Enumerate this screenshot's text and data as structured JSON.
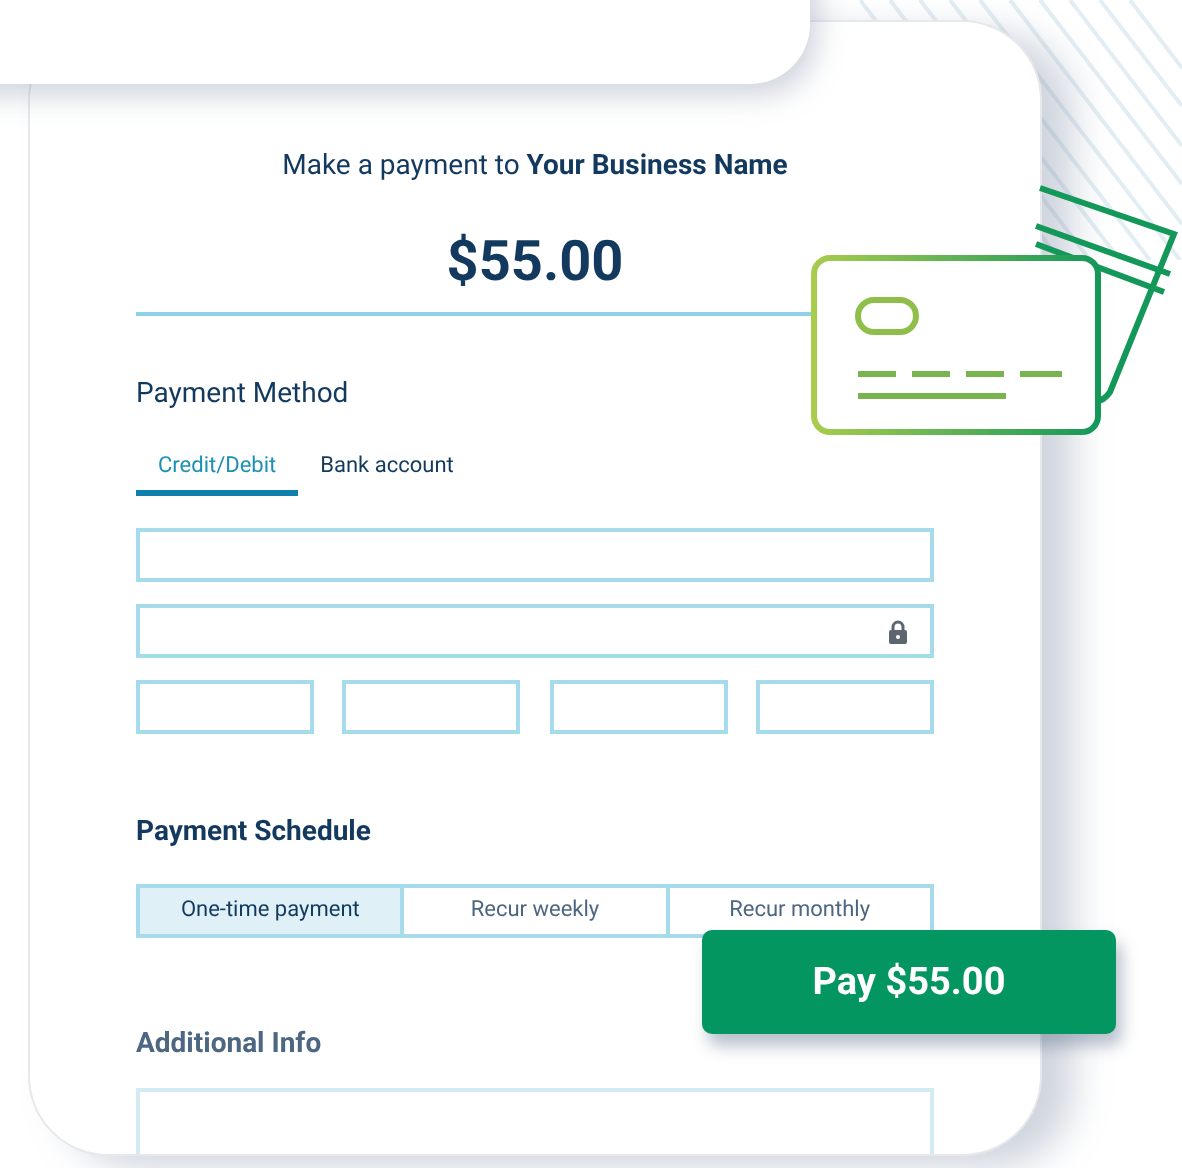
{
  "header": {
    "title": "Make a payment to **Your Business Name**",
    "amount": "$55.00"
  },
  "payment_method": {
    "heading": "Payment Method",
    "tabs": [
      {
        "label": "Credit/Debit",
        "selected": true
      },
      {
        "label": "Bank account",
        "selected": false
      }
    ],
    "field_rows": [
      [
        {
          "kind": "plain"
        }
      ],
      [
        {
          "kind": "secure"
        }
      ],
      [
        {
          "kind": "plain"
        },
        {
          "kind": "plain"
        },
        {
          "kind": "plain"
        },
        {
          "kind": "plain"
        }
      ]
    ]
  },
  "payment_schedule": {
    "heading": "Payment Schedule",
    "options": [
      {
        "label": "One-time payment",
        "selected": true
      },
      {
        "label": "Recur weekly",
        "selected": false
      },
      {
        "label": "Recur monthly",
        "selected": false
      }
    ]
  },
  "additional_info": {
    "heading": "Additional Info"
  },
  "pay_button": {
    "label": "Pay $55.00"
  }
}
